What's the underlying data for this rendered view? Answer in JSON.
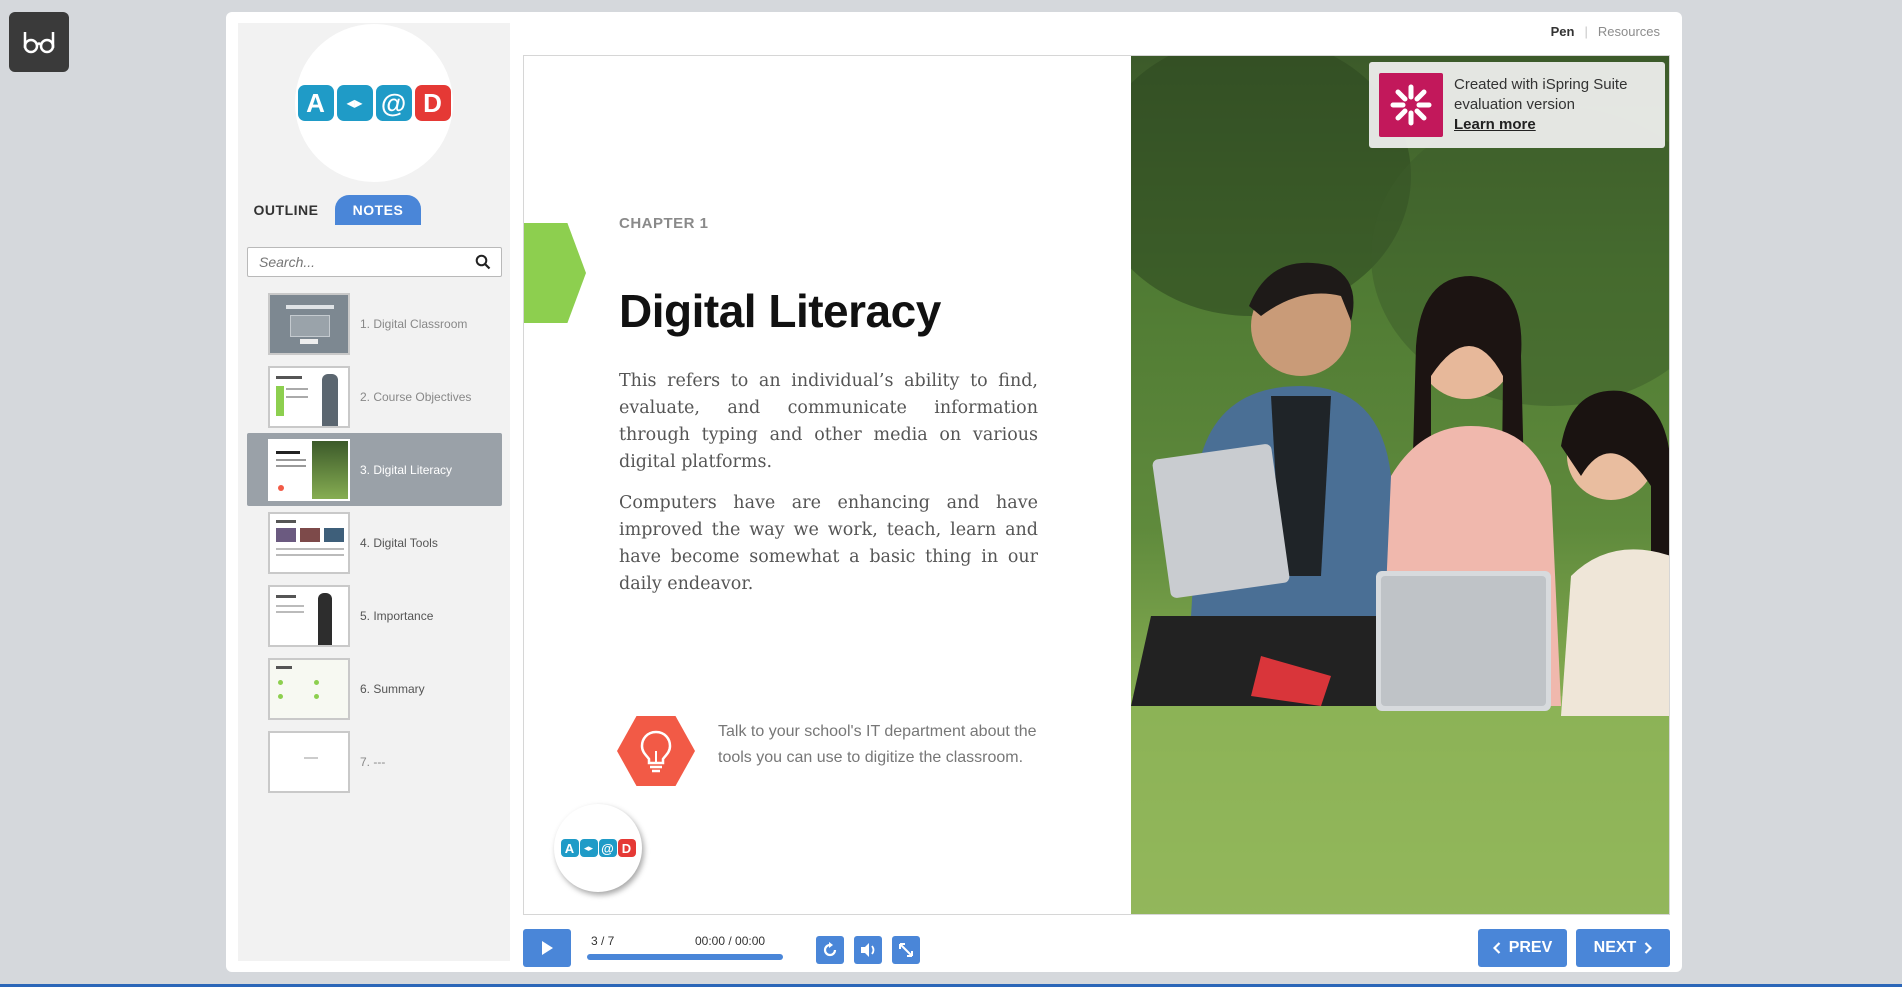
{
  "topbar": {
    "pen": "Pen",
    "resources": "Resources"
  },
  "sidebar": {
    "tabs": [
      {
        "label": "OUTLINE"
      },
      {
        "label": "NOTES"
      }
    ],
    "search_placeholder": "Search...",
    "outline": [
      {
        "label": "1. Digital Classroom",
        "active": false
      },
      {
        "label": "2. Course Objectives",
        "active": false
      },
      {
        "label": "3. Digital Literacy",
        "active": true
      },
      {
        "label": "4. Digital Tools",
        "active": false
      },
      {
        "label": "5. Importance",
        "active": false
      },
      {
        "label": "6. Summary",
        "active": false
      },
      {
        "label": "7. ---",
        "active": false
      }
    ]
  },
  "logo": {
    "letters": [
      "A",
      "◂▸",
      "@",
      "D"
    ],
    "colors": [
      "#1f9bc7",
      "#1f9bc7",
      "#1f9bc7",
      "#e53935"
    ]
  },
  "slide": {
    "chapter": "CHAPTER 1",
    "title": "Digital Literacy",
    "para1": "This refers to an individual’s ability to find, evaluate, and communicate information through typing and other media on various digital platforms.",
    "para2": "Computers have are enhancing and have improved the way we work, teach, learn and have become somewhat a basic thing in our daily endeavor.",
    "tip": "Talk to your school's IT department about the tools you can use to digitize the classroom.",
    "accent_green": "#8dcf4f",
    "accent_red": "#f25a46"
  },
  "ispring": {
    "line1": "Created with iSpring Suite",
    "line2": "evaluation version",
    "learn_more": "Learn more"
  },
  "controls": {
    "counter": "3 / 7",
    "time": "00:00 / 00:00",
    "prev": "PREV",
    "next": "NEXT",
    "accent": "#4a86d8"
  }
}
